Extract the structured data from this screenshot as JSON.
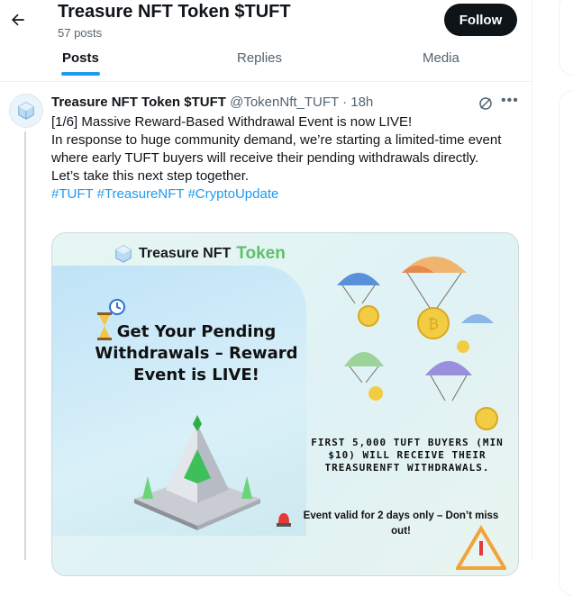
{
  "header": {
    "title": "Treasure NFT Token $TUFT",
    "post_count": "57 posts",
    "follow_label": "Follow"
  },
  "tabs": [
    {
      "label": "Posts",
      "active": true
    },
    {
      "label": "Replies",
      "active": false
    },
    {
      "label": "Media",
      "active": false
    }
  ],
  "tweet": {
    "author_name": "Treasure NFT Token $TUFT",
    "handle_time": "@TokenNft_TUFT · 18h",
    "line1": "[1/6] Massive Reward-Based Withdrawal Event is now LIVE!",
    "line2": "In response to huge community demand, we’re starting a limited-time event where early TUFT buyers will receive their pending withdrawals directly.",
    "line3": "Let’s take this next step together.",
    "hashtags": [
      "#TUFT",
      "#TreasureNFT",
      "#CryptoUpdate"
    ]
  },
  "media": {
    "brand_main": "Treasure NFT",
    "brand_accent": "Token",
    "headline": "Get Your Pending Withdrawals – Reward Event is LIVE!",
    "offer": "FIRST 5,000 TUFT BUYERS (MIN $10) WILL RECEIVE THEIR TREASURENFT WITHDRAWALS.",
    "validity": "Event valid for 2 days only – Don’t miss out!"
  },
  "colors": {
    "accent": "#1d9bf0",
    "follow_bg": "#0f1419",
    "brand_green": "#5fc06a"
  }
}
